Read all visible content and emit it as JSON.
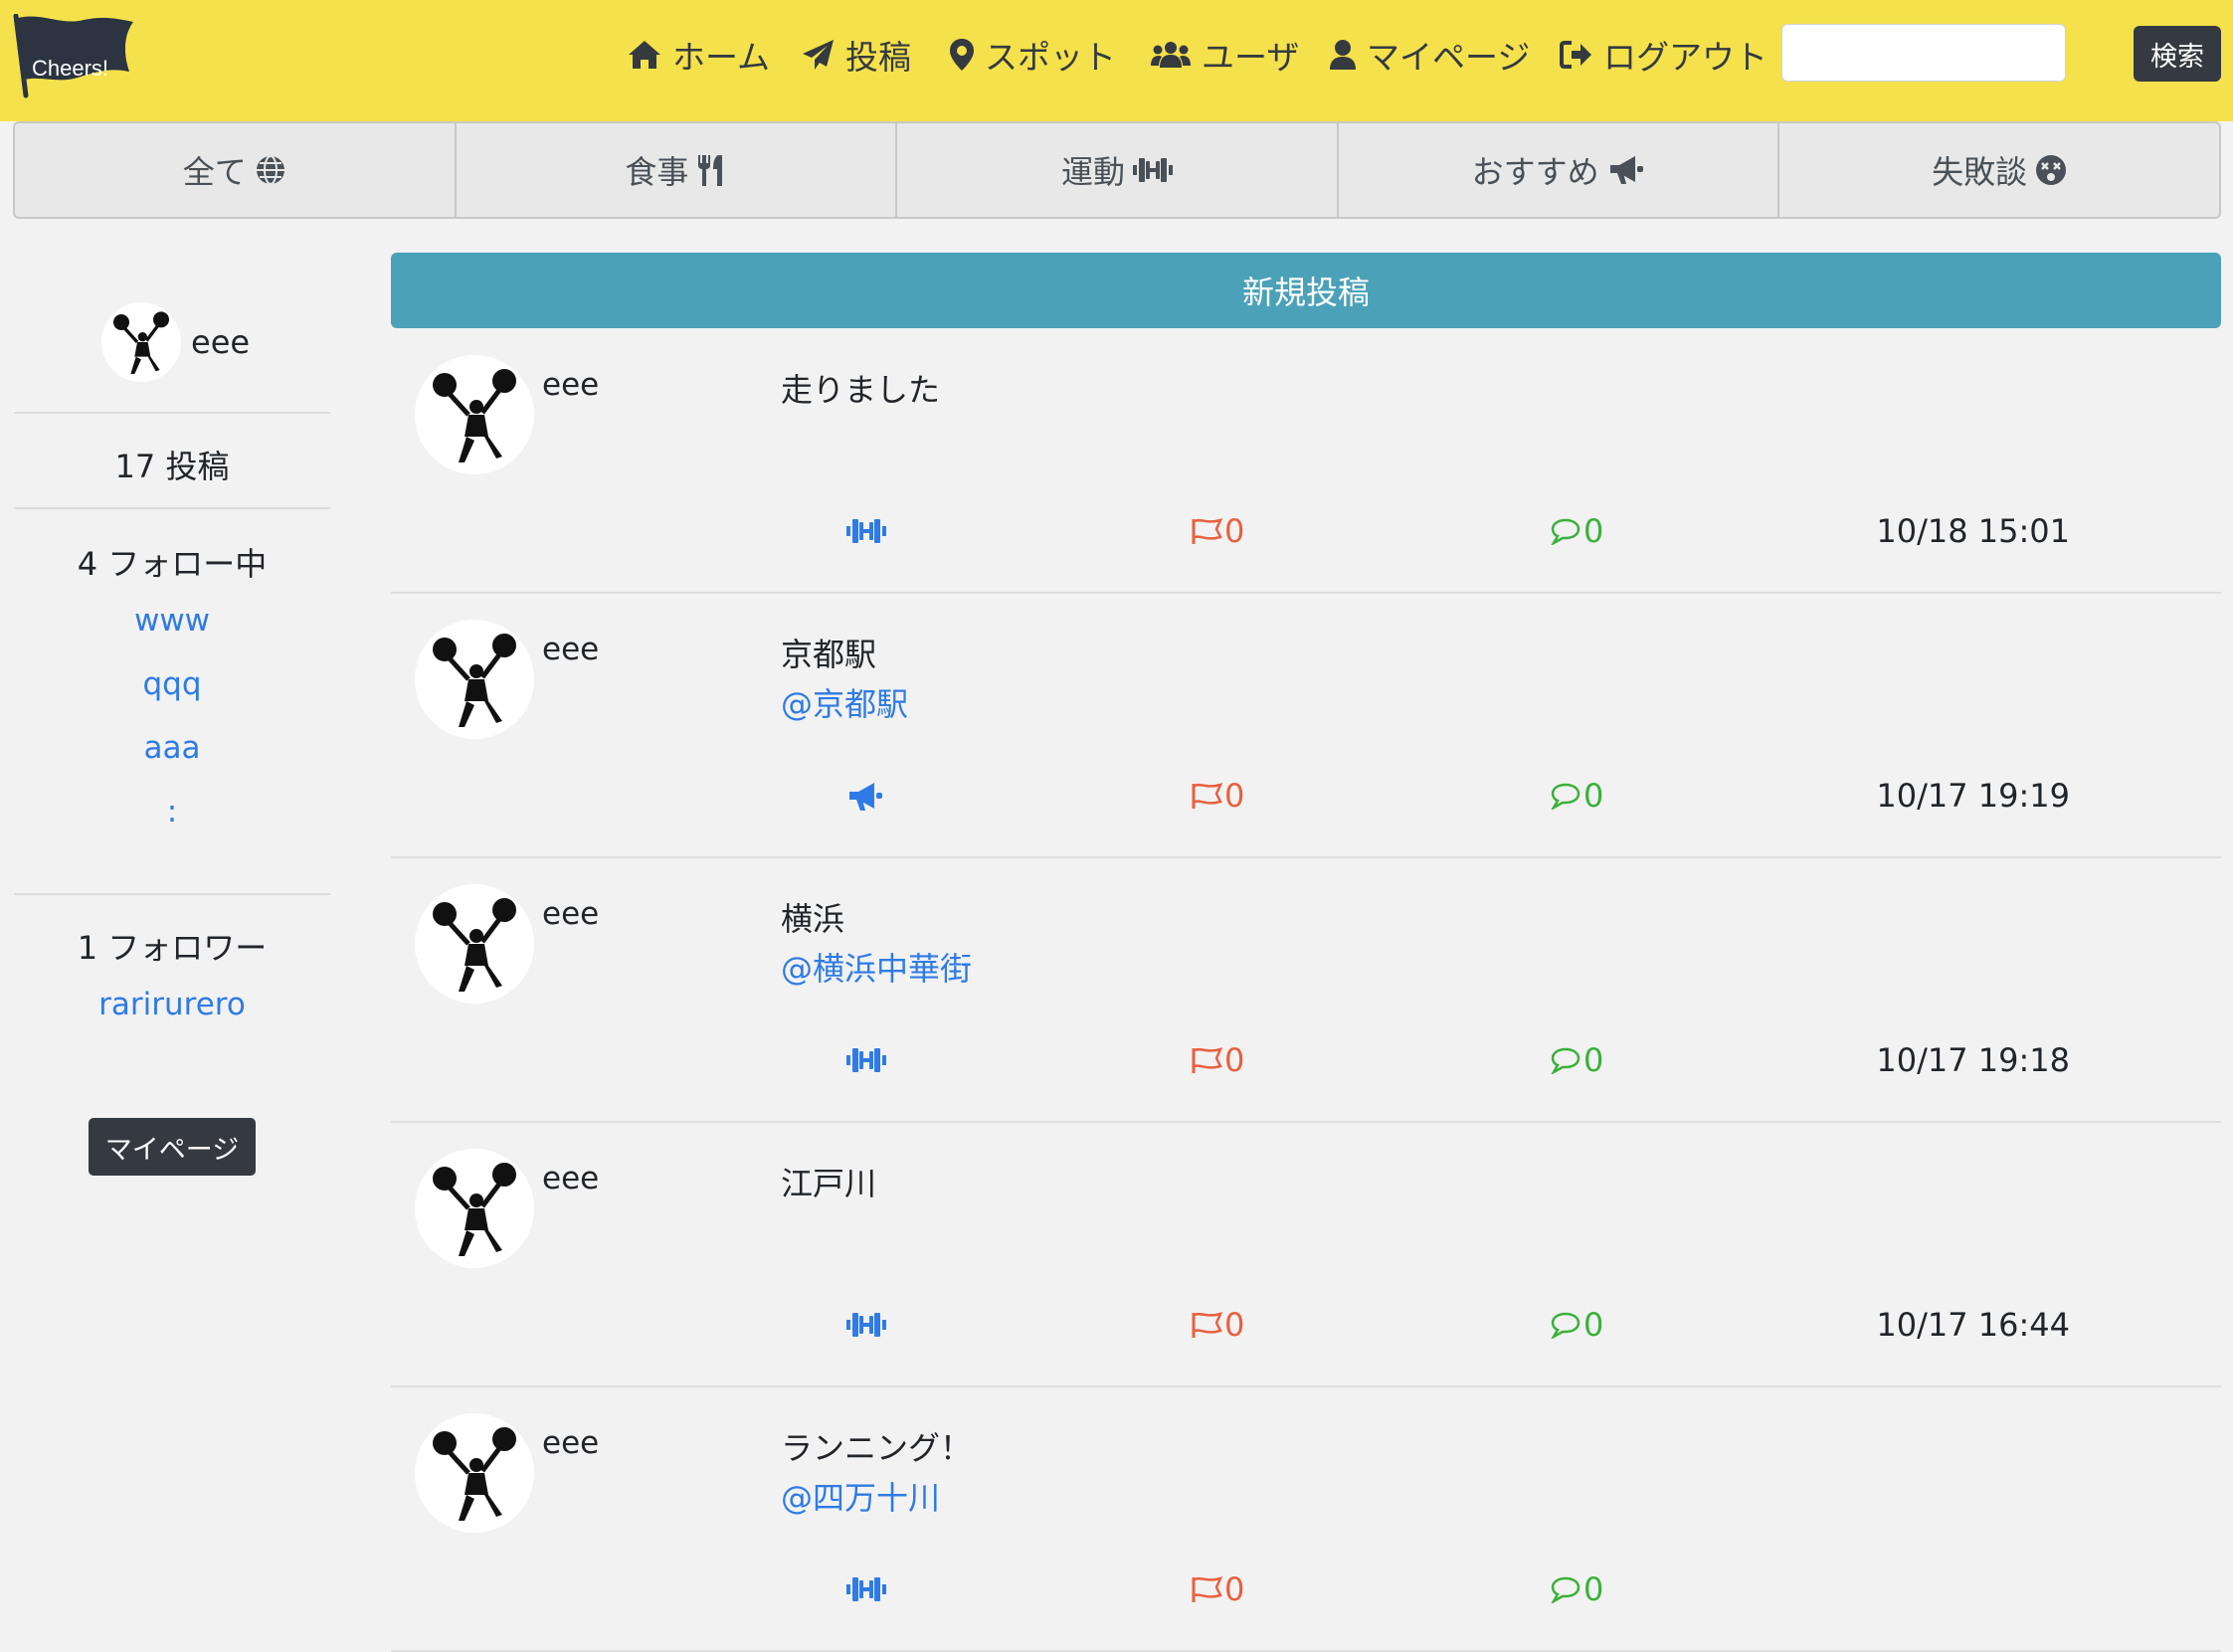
{
  "header": {
    "logo_text": "Cheers!",
    "nav": [
      {
        "icon": "home-icon",
        "label": "ホーム"
      },
      {
        "icon": "paper-plane-icon",
        "label": "投稿"
      },
      {
        "icon": "map-marker-icon",
        "label": "スポット"
      },
      {
        "icon": "users-icon",
        "label": "ユーザ"
      },
      {
        "icon": "user-icon",
        "label": "マイページ"
      },
      {
        "icon": "sign-out-icon",
        "label": "ログアウト"
      }
    ],
    "search": {
      "value": "",
      "button_label": "検索"
    }
  },
  "categories": [
    {
      "label": "全て",
      "icon": "globe-icon"
    },
    {
      "label": "食事",
      "icon": "utensils-icon"
    },
    {
      "label": "運動",
      "icon": "dumbbell-icon"
    },
    {
      "label": "おすすめ",
      "icon": "bullhorn-icon"
    },
    {
      "label": "失敗談",
      "icon": "dizzy-face-icon"
    }
  ],
  "sidebar": {
    "username": "eee",
    "post_count": "17 投稿",
    "following_label": "4 フォロー中",
    "following": [
      "www",
      "qqq",
      "aaa",
      ":"
    ],
    "followers_label": "1 フォロワー",
    "followers": [
      "rarirurero"
    ],
    "mypage_button": "マイページ"
  },
  "main": {
    "new_post_label": "新規投稿",
    "posts": [
      {
        "user": "eee",
        "text": "走りました",
        "spot": "",
        "category_icon": "dumbbell-icon",
        "flags": "0",
        "comments": "0",
        "time": "10/18 15:01"
      },
      {
        "user": "eee",
        "text": "京都駅",
        "spot": "@京都駅",
        "category_icon": "bullhorn-icon",
        "flags": "0",
        "comments": "0",
        "time": "10/17 19:19"
      },
      {
        "user": "eee",
        "text": "横浜",
        "spot": "@横浜中華街",
        "category_icon": "dumbbell-icon",
        "flags": "0",
        "comments": "0",
        "time": "10/17 19:18"
      },
      {
        "user": "eee",
        "text": "江戸川",
        "spot": "",
        "category_icon": "dumbbell-icon",
        "flags": "0",
        "comments": "0",
        "time": "10/17 16:44"
      },
      {
        "user": "eee",
        "text": "ランニング！",
        "spot": "@四万十川",
        "category_icon": "dumbbell-icon",
        "flags": "0",
        "comments": "0",
        "time": ""
      }
    ]
  },
  "colors": {
    "header_bg": "#f5e14c",
    "new_post_bg": "#4ba1b8",
    "link": "#2f7be5",
    "flag": "#e8603f",
    "comment": "#3cb03c",
    "dark_button": "#343a40"
  }
}
